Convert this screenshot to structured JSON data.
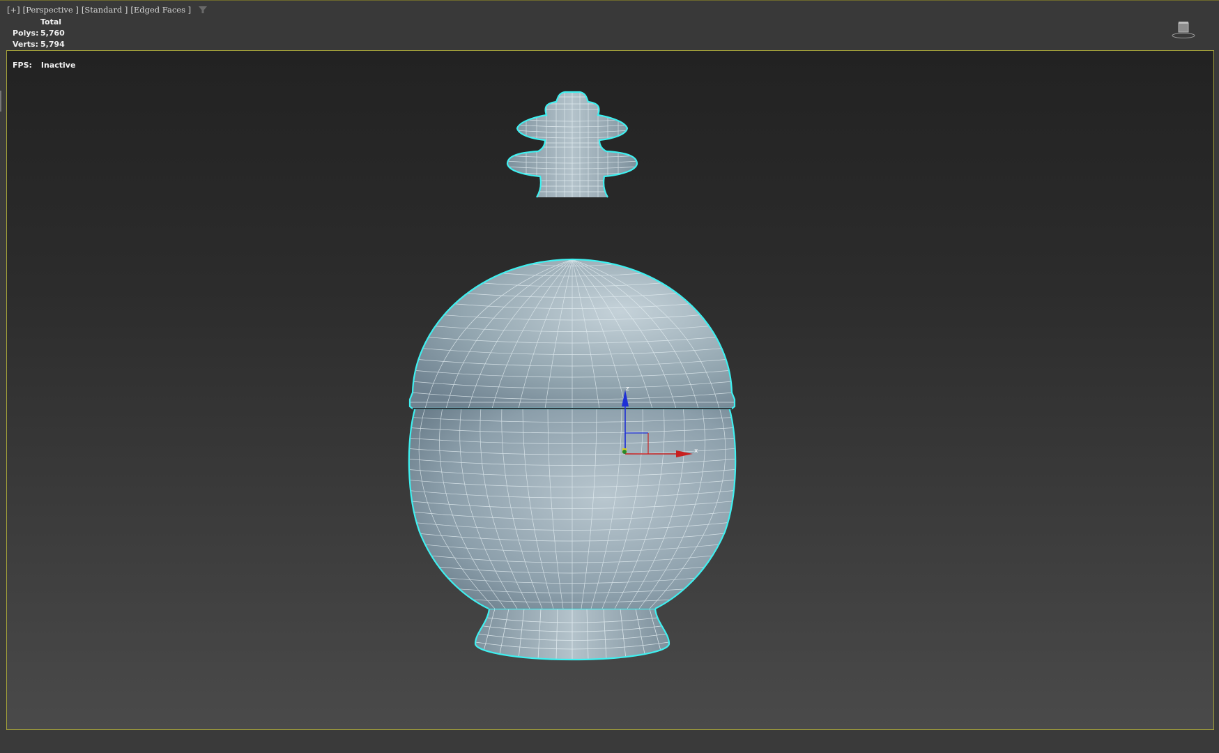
{
  "viewport": {
    "labels": [
      "[+]",
      "[Perspective ]",
      "[Standard ]",
      "[Edged Faces ]"
    ],
    "stats": {
      "header": "Total",
      "polys_label": "Polys:",
      "polys_value": "5,760",
      "verts_label": "Verts:",
      "verts_value": "5,794"
    },
    "fps_label": "FPS:",
    "fps_value": "Inactive"
  },
  "gizmo": {
    "z_label": "z",
    "x_label": "x"
  },
  "colors": {
    "selection_outline": "#3ff0f0",
    "wire": "#e6f0f4",
    "mesh_shade": "#9fb1bb",
    "active_border": "#a4a23a",
    "axis_z": "#1e2fd6",
    "axis_x": "#c82020"
  },
  "icons": [
    "filter-icon",
    "viewcube-icon",
    "transform-gizmo-icon"
  ]
}
